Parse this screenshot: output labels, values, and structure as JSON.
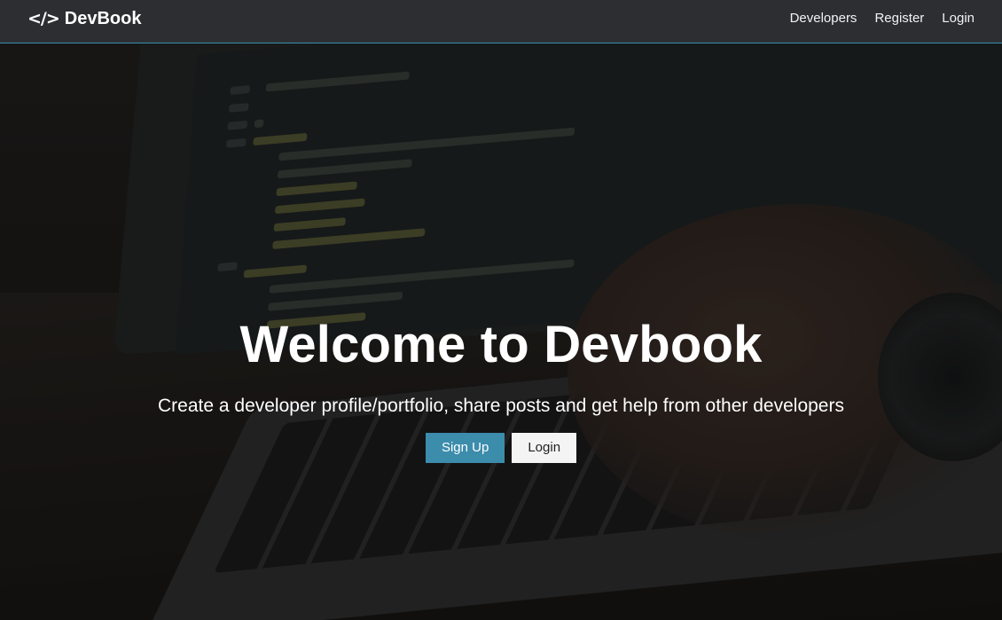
{
  "navbar": {
    "brand": {
      "icon": "code-icon",
      "icon_glyph": "</>",
      "name": "DevBook"
    },
    "links": [
      {
        "label": "Developers"
      },
      {
        "label": "Register"
      },
      {
        "label": "Login"
      }
    ],
    "accent_color": "#3a8fb0"
  },
  "landing": {
    "title": "Welcome to Devbook",
    "lead": "Create a developer profile/portfolio, share posts and get help from other developers",
    "buttons": {
      "signup_label": "Sign Up",
      "login_label": "Login"
    },
    "primary_color": "#3c8cac",
    "light_color": "#f4f4f4"
  }
}
